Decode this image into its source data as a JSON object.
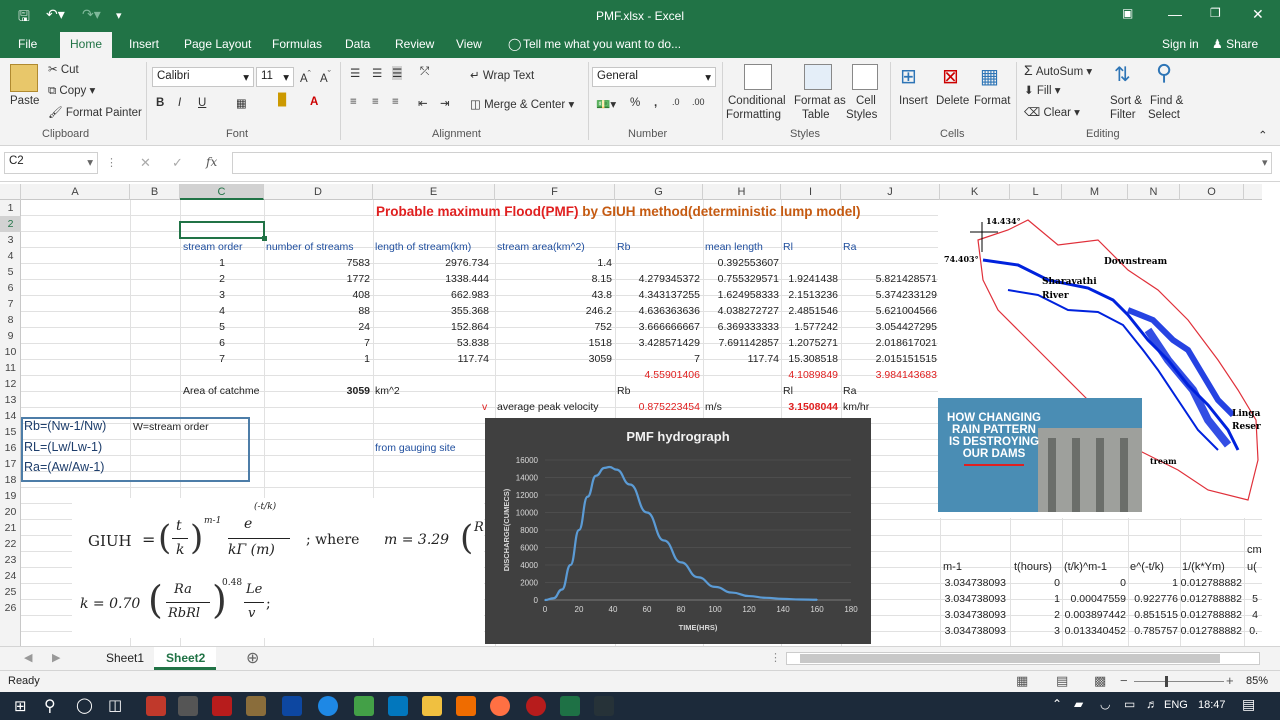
{
  "window": {
    "title": "PMF.xlsx - Excel"
  },
  "tabs": [
    {
      "label": "File"
    },
    {
      "label": "Home"
    },
    {
      "label": "Insert"
    },
    {
      "label": "Page Layout"
    },
    {
      "label": "Formulas"
    },
    {
      "label": "Data"
    },
    {
      "label": "Review"
    },
    {
      "label": "View"
    }
  ],
  "tell_me": "Tell me what you want to do...",
  "signin": "Sign in",
  "share": "Share",
  "ribbon": {
    "paste": "Paste",
    "cut": "Cut",
    "copy": "Copy",
    "format_painter": "Format Painter",
    "clipboard": "Clipboard",
    "font_name": "Calibri",
    "font_size": "11",
    "font_group": "Font",
    "wrap_text": "Wrap Text",
    "merge_center": "Merge & Center",
    "alignment": "Alignment",
    "number_format": "General",
    "number": "Number",
    "conditional": "Conditional",
    "formatting": "Formatting",
    "format_as": "Format as",
    "table": "Table",
    "cell": "Cell",
    "styles_lbl": "Styles",
    "styles": "Styles",
    "insert": "Insert",
    "delete": "Delete",
    "format": "Format",
    "cells": "Cells",
    "autosum": "AutoSum",
    "fill": "Fill",
    "clear": "Clear",
    "sort": "Sort &",
    "filter": "Filter",
    "find": "Find &",
    "select": "Select",
    "editing": "Editing"
  },
  "namebox": "C2",
  "fx": "fx",
  "columns": [
    "A",
    "B",
    "C",
    "D",
    "E",
    "F",
    "G",
    "H",
    "I",
    "J",
    "K",
    "L",
    "M",
    "N",
    "O"
  ],
  "rows": [
    "1",
    "2",
    "3",
    "4",
    "5",
    "6",
    "7",
    "8",
    "9",
    "10",
    "11",
    "12",
    "13",
    "14",
    "15",
    "16",
    "17",
    "18",
    "19",
    "20",
    "21",
    "22",
    "23",
    "24",
    "25",
    "26"
  ],
  "sheet": {
    "title_a": "Probable maximum Flood(PMF) ",
    "title_b": "by GIUH method(deterministic lump model)",
    "headers": [
      "stream  order",
      "number of streams",
      "length of stream(km)",
      "stream area(km^2)",
      "Rb",
      "mean length",
      "Rl",
      "Ra"
    ],
    "table": [
      [
        "1",
        "7583",
        "2976.734",
        "1.4",
        "",
        "0.392553607",
        "",
        ""
      ],
      [
        "2",
        "1772",
        "1338.444",
        "8.15",
        "4.279345372",
        "0.755329571",
        "1.9241438",
        "5.821428571"
      ],
      [
        "3",
        "408",
        "662.983",
        "43.8",
        "4.343137255",
        "1.624958333",
        "2.1513236",
        "5.374233129"
      ],
      [
        "4",
        "88",
        "355.368",
        "246.2",
        "4.636363636",
        "4.038272727",
        "2.4851546",
        "5.621004566"
      ],
      [
        "5",
        "24",
        "152.864",
        "752",
        "3.666666667",
        "6.369333333",
        "1.577242",
        "3.054427295"
      ],
      [
        "6",
        "7",
        "53.838",
        "1518",
        "3.428571429",
        "7.691142857",
        "1.2075271",
        "2.018617021"
      ],
      [
        "7",
        "1",
        "117.74",
        "3059",
        "7",
        "117.74",
        "15.308518",
        "2.015151515"
      ]
    ],
    "avg_rb": "4.55901406",
    "avg_rl": "4.1089849",
    "avg_ra": "3.984143683",
    "area_label": "Area of catchme",
    "area_value": "3059",
    "area_unit": "km^2",
    "rb_lbl": "Rb",
    "rl_lbl": "Rl",
    "ra_lbl": "Ra",
    "v": "v",
    "avg_peak_velocity": "average peak velocity",
    "velocity": "0.875223454",
    "vel_unit": "m/s",
    "velocity_km": "3.1508044",
    "vel_unit_km": "km/hr",
    "rb_def": "Rb=(Nw-1/Nw)",
    "rl_def": "RL=(Lw/Lw-1)",
    "ra_def": "Ra=(Aw/Aw-1)",
    "w_def": "W=stream order",
    "gauging": "from gauging site",
    "lower_headers": [
      "m-1",
      "t(hours)",
      "(t/k)^m-1",
      "e^(-t/k)",
      "1/(k*Ym)",
      "cm",
      "u("
    ],
    "lower_rows": [
      [
        "3.034738093",
        "0",
        "0",
        "1",
        "0.012788882",
        ""
      ],
      [
        "3.034738093",
        "1",
        "0.00047559",
        "0.922776",
        "0.012788882",
        "5"
      ],
      [
        "3.034738093",
        "2",
        "0.003897442",
        "0.851515",
        "0.012788882",
        "4"
      ],
      [
        "3.034738093",
        "3",
        "0.013340452",
        "0.785757",
        "0.012788882",
        "0."
      ]
    ]
  },
  "formula": {
    "giuh": "GIUH",
    "where": "; where",
    "m_eq": "m = 3.29",
    "k_eq": "k = 0.70",
    "exp": "m-1",
    "exp2": "0.48",
    "t": "t",
    "k": "k",
    "e": "e",
    "kgamma": "kΓ (m)",
    "Ra": "Ra",
    "RbRl": "RbRl",
    "Le": "Le",
    "vv": "v",
    "R": "R"
  },
  "chart_data": {
    "type": "line",
    "title": "PMF hydrograph",
    "xlabel": "TIME(HRS)",
    "ylabel": "DISCHARGE(CUMECS)",
    "xlim": [
      0,
      180
    ],
    "ylim": [
      0,
      16000
    ],
    "xticks": [
      0,
      20,
      40,
      60,
      80,
      100,
      120,
      140,
      160,
      180
    ],
    "yticks": [
      0,
      2000,
      4000,
      6000,
      8000,
      10000,
      12000,
      14000,
      16000
    ],
    "series": [
      {
        "x": [
          0,
          5,
          10,
          15,
          20,
          25,
          30,
          35,
          38,
          42,
          50,
          60,
          70,
          80,
          90,
          100,
          110,
          120,
          130,
          140,
          150,
          160
        ],
        "values": [
          0,
          200,
          1200,
          4000,
          8000,
          11800,
          14200,
          15100,
          15200,
          14900,
          13200,
          10000,
          6800,
          4300,
          2600,
          1500,
          850,
          450,
          250,
          130,
          60,
          30
        ]
      }
    ],
    "color": "#5b9bd5"
  },
  "map": {
    "lat": "14.434°",
    "lon": "74.403°",
    "downstream": "Downstream",
    "river1": "Sharavathi",
    "river2": "River",
    "linga": "Linga",
    "reser": "Reser",
    "stream": "tream"
  },
  "ad": {
    "line1": "HOW CHANGING",
    "line2": "RAIN PATTERN",
    "line3": "IS DESTROYING",
    "line4": "OUR DAMS"
  },
  "sheets": [
    {
      "label": "Sheet1"
    },
    {
      "label": "Sheet2"
    }
  ],
  "status": {
    "ready": "Ready",
    "zoom": "85%"
  },
  "taskbar": {
    "lang": "ENG",
    "time": "18:47"
  }
}
